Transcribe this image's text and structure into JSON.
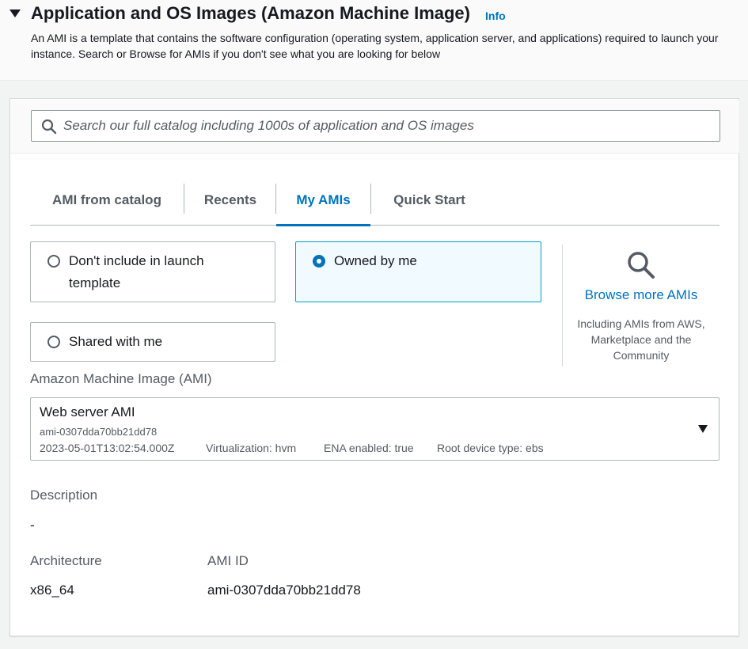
{
  "section": {
    "title": "Application and OS Images (Amazon Machine Image)",
    "info_link": "Info",
    "description": "An AMI is a template that contains the software configuration (operating system, application server, and applications) required to launch your instance. Search or Browse for AMIs if you don't see what you are looking for below"
  },
  "search": {
    "placeholder": "Search our full catalog including 1000s of application and OS images",
    "value": ""
  },
  "tabs": [
    {
      "label": "AMI from catalog",
      "active": false
    },
    {
      "label": "Recents",
      "active": false
    },
    {
      "label": "My AMIs",
      "active": true
    },
    {
      "label": "Quick Start",
      "active": false
    }
  ],
  "ownership": {
    "options": [
      {
        "label_line1": "Don't include in launch",
        "label_line2": "template",
        "selected": false
      },
      {
        "label": "Owned by me",
        "selected": true
      },
      {
        "label": "Shared with me",
        "selected": false
      }
    ]
  },
  "browse": {
    "link": "Browse more AMIs",
    "description": "Including AMIs from AWS, Marketplace and the Community"
  },
  "ami_field": {
    "label": "Amazon Machine Image (AMI)",
    "name": "Web server AMI",
    "id": "ami-0307dda70bb21dd78",
    "created": "2023-05-01T13:02:54.000Z",
    "virtualization": "Virtualization: hvm",
    "ena": "ENA enabled: true",
    "root_device": "Root device type: ebs"
  },
  "details": {
    "description_label": "Description",
    "description_value": "-",
    "architecture_label": "Architecture",
    "architecture_value": "x86_64",
    "ami_id_label": "AMI ID",
    "ami_id_value": "ami-0307dda70bb21dd78"
  },
  "colors": {
    "link": "#0073bb",
    "selected_bg": "#f1faff",
    "selected_border": "#00a1c9"
  }
}
